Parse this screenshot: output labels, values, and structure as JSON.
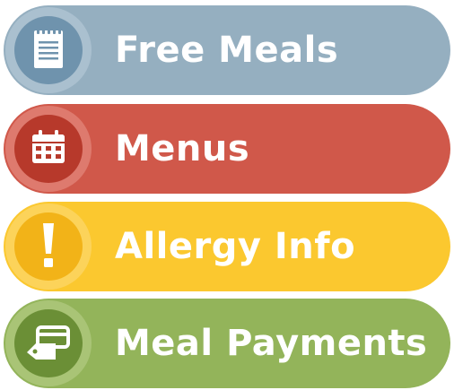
{
  "menu": {
    "items": [
      {
        "label": "Free Meals",
        "icon": "document-list-icon",
        "color": "#95afc0"
      },
      {
        "label": "Menus",
        "icon": "calendar-icon",
        "color": "#d0584a"
      },
      {
        "label": "Allergy Info",
        "icon": "exclamation-icon",
        "color": "#fbc82f"
      },
      {
        "label": "Meal Payments",
        "icon": "payment-card-tag-icon",
        "color": "#93b45a"
      }
    ]
  }
}
